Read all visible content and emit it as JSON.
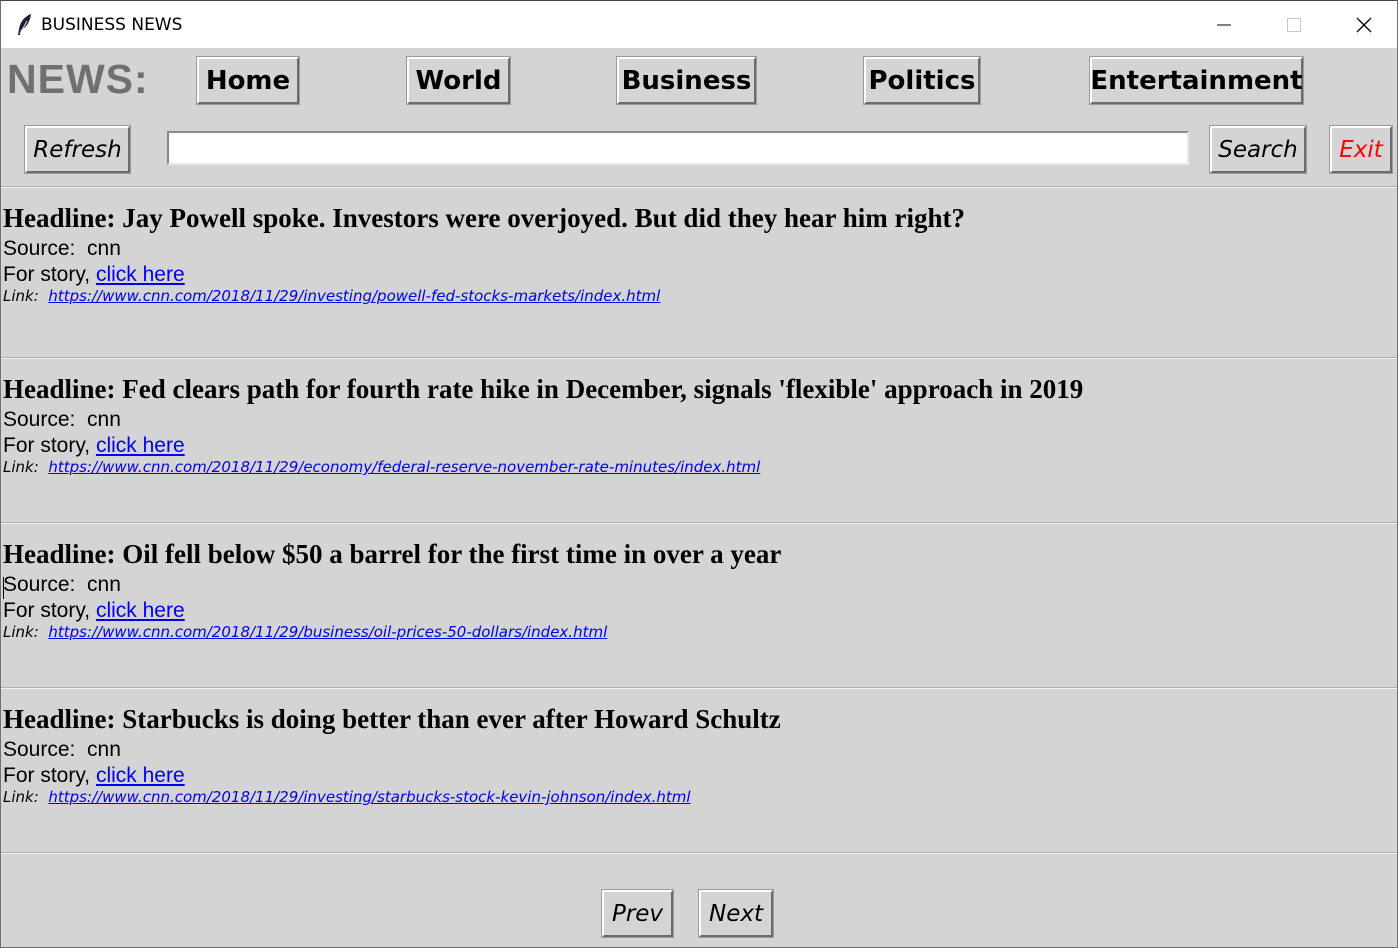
{
  "window": {
    "title": "BUSINESS NEWS",
    "icon": "feather-icon",
    "controls": [
      "minimize-icon",
      "maximize-icon",
      "close-icon"
    ]
  },
  "toolbar": {
    "news_label": "NEWS:",
    "nav": [
      "Home",
      "World",
      "Business",
      "Politics",
      "Entertainment"
    ],
    "refresh_label": "Refresh",
    "search_value": "",
    "search_label": "Search",
    "exit_label": "Exit",
    "exit_color": "#ff0000"
  },
  "articles": [
    {
      "headline": "Headline: Jay Powell spoke. Investors were overjoyed. But did they hear him right?",
      "source_prefix": "Source:  ",
      "source": "cnn",
      "story_prefix": "For story, ",
      "story_link": "click here",
      "link_prefix": "Link:  ",
      "url": "https://www.cnn.com/2018/11/29/investing/powell-fed-stocks-markets/index.html"
    },
    {
      "headline": "Headline: Fed clears path for fourth rate hike in December, signals 'flexible' approach in 2019",
      "source_prefix": "Source:  ",
      "source": "cnn",
      "story_prefix": "For story, ",
      "story_link": "click here",
      "link_prefix": "Link:  ",
      "url": "https://www.cnn.com/2018/11/29/economy/federal-reserve-november-rate-minutes/index.html"
    },
    {
      "headline": "Headline: Oil fell below $50 a barrel for the first time in over a year",
      "source_prefix": "Source:  ",
      "source": "cnn",
      "story_prefix": "For story, ",
      "story_link": "click here",
      "link_prefix": "Link:  ",
      "url": "https://www.cnn.com/2018/11/29/business/oil-prices-50-dollars/index.html"
    },
    {
      "headline": "Headline: Starbucks is doing better than ever after Howard Schultz",
      "source_prefix": "Source:  ",
      "source": "cnn",
      "story_prefix": "For story, ",
      "story_link": "click here",
      "link_prefix": "Link:  ",
      "url": "https://www.cnn.com/2018/11/29/investing/starbucks-stock-kevin-johnson/index.html"
    }
  ],
  "pagination": {
    "prev_label": "Prev",
    "next_label": "Next"
  }
}
